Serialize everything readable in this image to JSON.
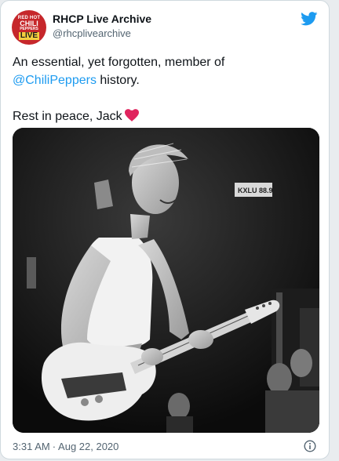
{
  "tweet": {
    "author": {
      "display_name": "RHCP Live Archive",
      "handle": "@rhcplivearchive",
      "avatar_lines": [
        "RED HOT",
        "CHILI",
        "PEPPERS",
        "LIVE"
      ]
    },
    "text_line1": "An essential, yet forgotten, member of",
    "mention": "@ChiliPeppers",
    "text_line2_suffix": " history.",
    "text_line3": "Rest in peace, Jack",
    "emoji": "heart-icon",
    "image": {
      "sign_text": "KXLU 88.9"
    },
    "time": "3:31 AM",
    "separator": "·",
    "date": "Aug 22, 2020"
  },
  "icons": {
    "brand": "twitter-bird-icon",
    "info": "info-icon"
  },
  "colors": {
    "accent": "#1d9bf0",
    "heart": "#e0245e",
    "text": "#0f1419",
    "muted": "#536471"
  }
}
